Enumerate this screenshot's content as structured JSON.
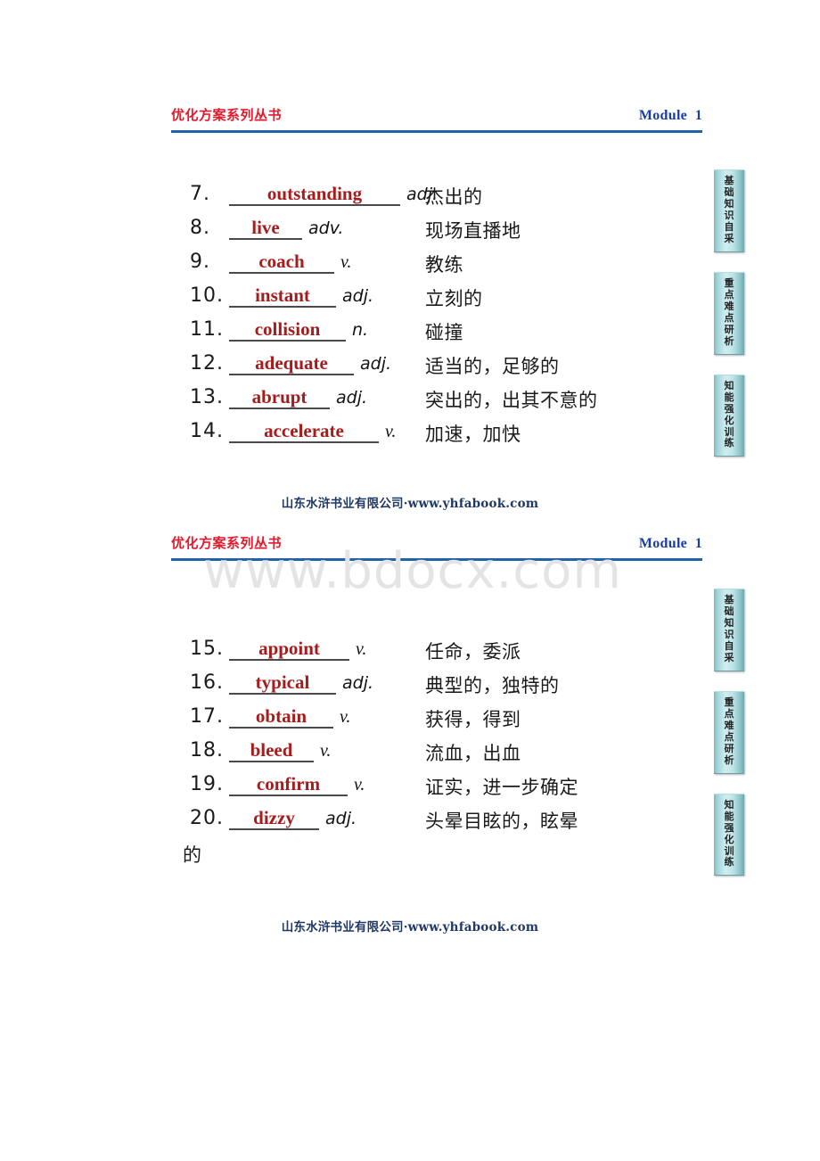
{
  "document": {
    "header": {
      "brand": "优化方案系列丛书",
      "module": "Module  1"
    },
    "footer": "山东水浒书业有限公司·www.yhfabook.com",
    "watermark": "www.bdocx.com",
    "side_tabs": [
      "基础知识自采",
      "重点难点研析",
      "知能强化训练"
    ],
    "colors": {
      "brand_red": "#e8192c",
      "module_blue": "#1b3d9c",
      "rule_blue": "#1f63ab",
      "answer_red": "#a61b1b",
      "footer_navy": "#1f3864",
      "tab_teal": "#cfeef0",
      "watermark_gray": "#e4e4e6"
    }
  },
  "pages": [
    {
      "id": "page-1",
      "entries": [
        {
          "num": "7.",
          "word": "outstanding",
          "blank_width": 192,
          "pos": "adj.",
          "pos_style": "sans",
          "definition": "杰出的"
        },
        {
          "num": "8.",
          "word": "live",
          "blank_width": 82,
          "pos": "adv.",
          "pos_style": "sans",
          "definition": "现场直播地"
        },
        {
          "num": "9.",
          "word": "coach",
          "blank_width": 118,
          "pos": "v.",
          "pos_style": "serif",
          "definition": "教练"
        },
        {
          "num": "10.",
          "word": "instant",
          "blank_width": 120,
          "pos": "adj.",
          "pos_style": "sans",
          "definition": "立刻的"
        },
        {
          "num": "11.",
          "word": "collision",
          "blank_width": 131,
          "pos": "n.",
          "pos_style": "sans",
          "definition": "碰撞"
        },
        {
          "num": "12.",
          "word": "adequate",
          "blank_width": 140,
          "pos": "adj.",
          "pos_style": "sans",
          "definition": "适当的，足够的"
        },
        {
          "num": "13.",
          "word": "abrupt",
          "blank_width": 113,
          "pos": "adj.",
          "pos_style": "sans",
          "definition": "突出的，出其不意的"
        },
        {
          "num": "14.",
          "word": "accelerate",
          "blank_width": 168,
          "pos": "v.",
          "pos_style": "serif",
          "definition": "加速，加快"
        }
      ]
    },
    {
      "id": "page-2",
      "entries": [
        {
          "num": "15.",
          "word": "appoint",
          "blank_width": 135,
          "pos": "v.",
          "pos_style": "serif",
          "definition": "任命，委派"
        },
        {
          "num": "16.",
          "word": "typical",
          "blank_width": 120,
          "pos": "adj.",
          "pos_style": "sans",
          "definition": "典型的，独特的"
        },
        {
          "num": "17.",
          "word": "obtain",
          "blank_width": 117,
          "pos": "v.",
          "pos_style": "serif",
          "definition": "获得，得到"
        },
        {
          "num": "18.",
          "word": "bleed",
          "blank_width": 95,
          "pos": "v.",
          "pos_style": "serif",
          "definition": "流血，出血"
        },
        {
          "num": "19.",
          "word": "confirm",
          "blank_width": 133,
          "pos": "v.",
          "pos_style": "serif",
          "definition": "证实，进一步确定"
        },
        {
          "num": "20.",
          "word": "dizzy",
          "blank_width": 101,
          "pos": "adj.",
          "pos_style": "sans",
          "definition": "头晕目眩的，眩晕"
        }
      ],
      "overflow_text": "的"
    }
  ]
}
